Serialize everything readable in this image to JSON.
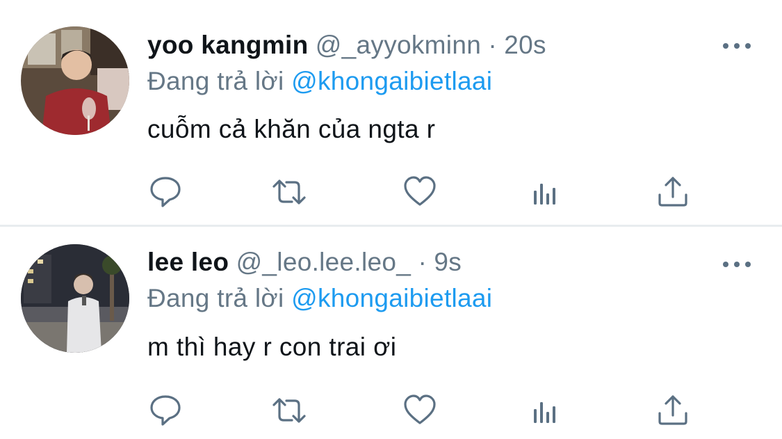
{
  "tweets": [
    {
      "display_name": "yoo kangmin",
      "handle": "@_ayyokminn",
      "separator": "·",
      "time": "20s",
      "reply_prefix": "Đang trả lời",
      "reply_to": "@khongaibietlaai",
      "text": "cuỗm cả khăn của ngta r",
      "more_icon": "more-horizontal-icon",
      "actions": [
        "reply-icon",
        "retweet-icon",
        "like-icon",
        "analytics-icon",
        "share-icon"
      ]
    },
    {
      "display_name": "lee leo",
      "handle": "@_leo.lee.leo_",
      "separator": "·",
      "time": "9s",
      "reply_prefix": "Đang trả lời",
      "reply_to": "@khongaibietlaai",
      "text": "m thì hay r con trai ơi",
      "more_icon": "more-horizontal-icon",
      "actions": [
        "reply-icon",
        "retweet-icon",
        "like-icon",
        "analytics-icon",
        "share-icon"
      ]
    }
  ],
  "colors": {
    "text_primary": "#0f1419",
    "text_secondary": "#657786",
    "link": "#1d9bf0",
    "icon": "#5b7083",
    "divider": "#e8ecef"
  }
}
